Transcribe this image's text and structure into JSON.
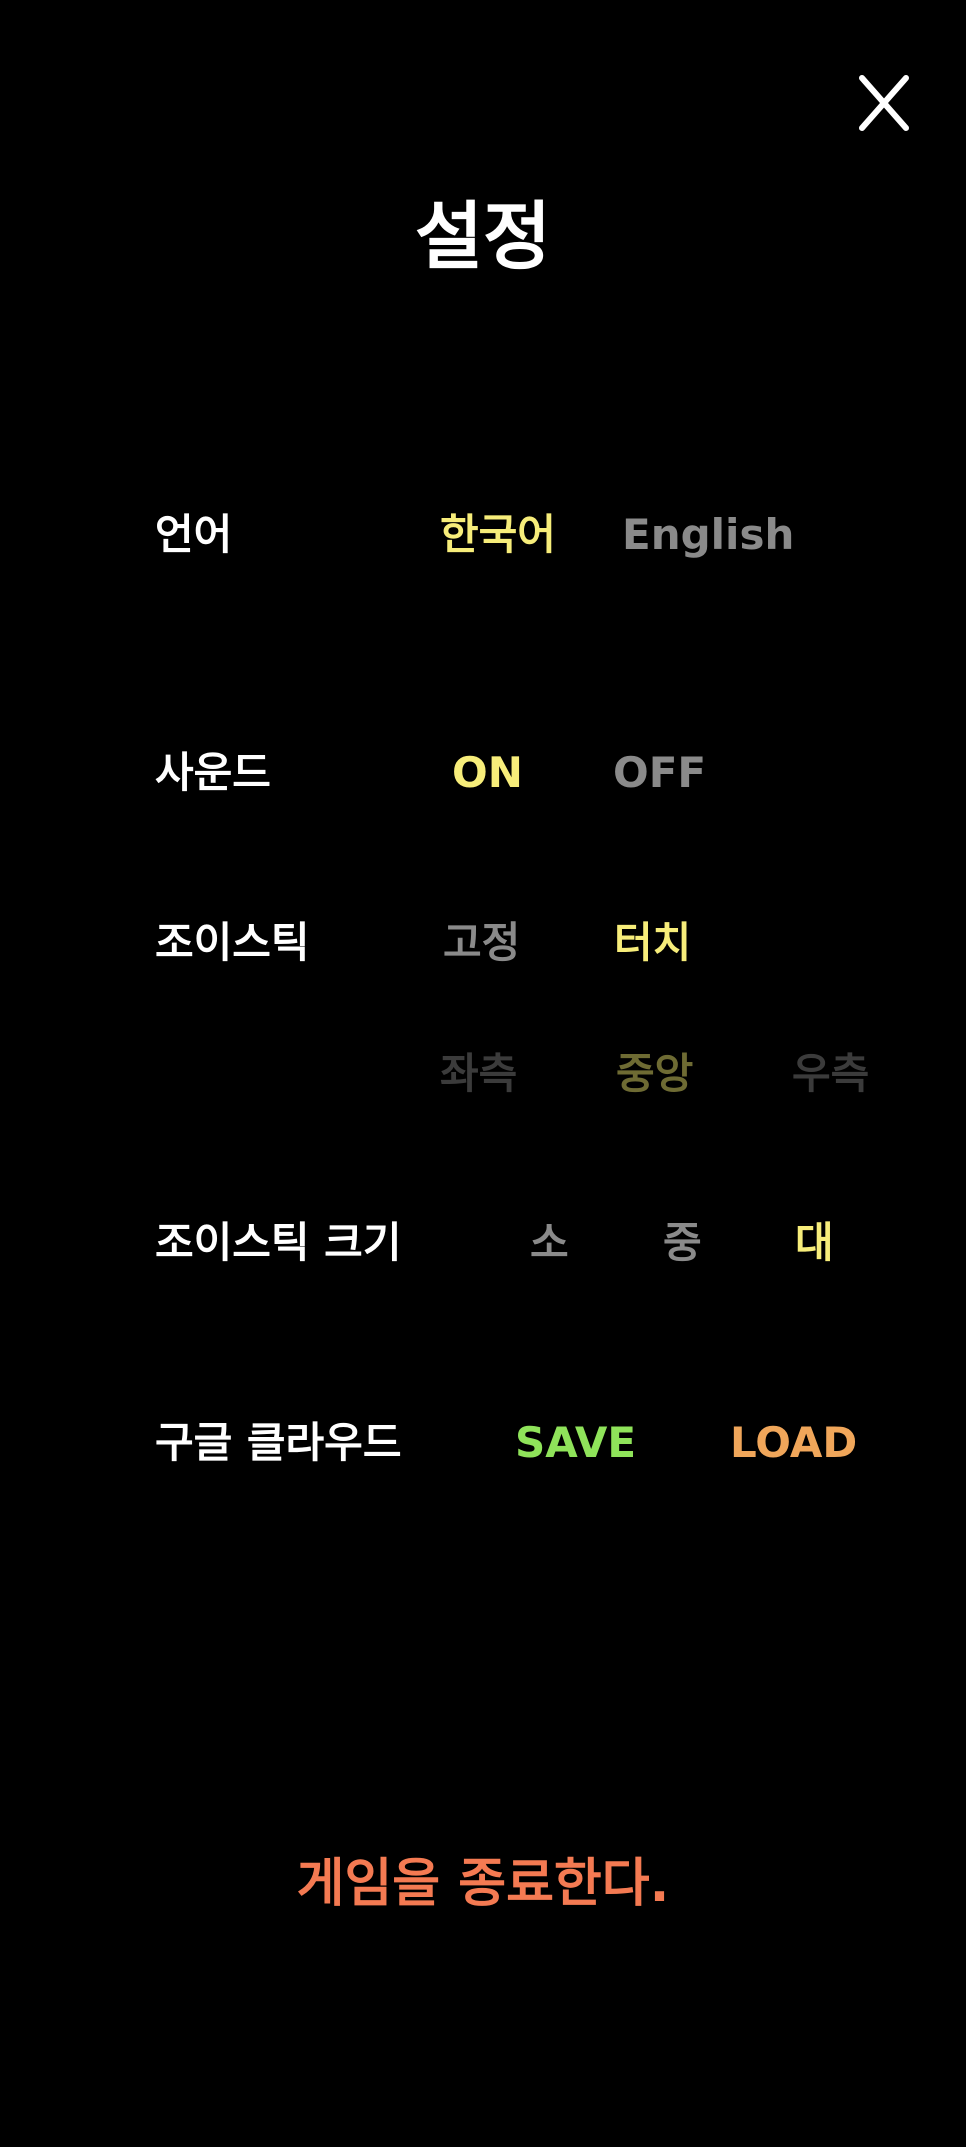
{
  "title": "설정",
  "language": {
    "label": "언어",
    "options": [
      "한국어",
      "English"
    ],
    "selected": "한국어"
  },
  "sound": {
    "label": "사운드",
    "options": [
      "ON",
      "OFF"
    ],
    "selected": "ON"
  },
  "joystick": {
    "label": "조이스틱",
    "options": [
      "고정",
      "터치"
    ],
    "selected": "터치",
    "position_options": [
      "좌측",
      "중앙",
      "우측"
    ],
    "position_selected": "중앙"
  },
  "joystick_size": {
    "label": "조이스틱 크기",
    "options": [
      "소",
      "중",
      "대"
    ],
    "selected": "대"
  },
  "cloud": {
    "label": "구글 클라우드",
    "save_label": "SAVE",
    "load_label": "LOAD"
  },
  "quit_label": "게임을 종료한다.",
  "colors": {
    "selected": "#f7ed7a",
    "unselected": "#8a8a8a",
    "disabled": "#3b3b3b",
    "save": "#8fe35a",
    "load": "#f0a65a",
    "quit": "#f47a52"
  }
}
